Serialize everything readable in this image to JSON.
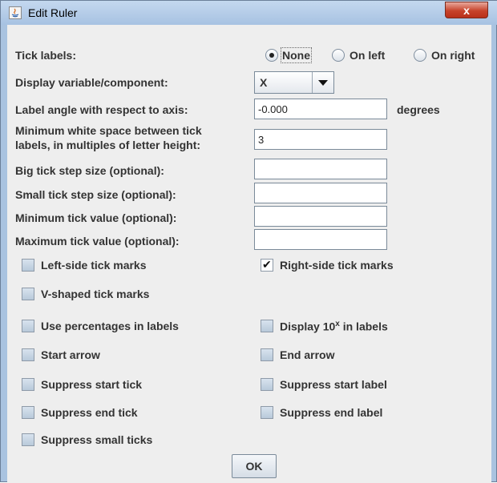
{
  "window": {
    "title": "Edit Ruler",
    "close_symbol": "x"
  },
  "tick_labels": {
    "label": "Tick labels:",
    "options": [
      "None",
      "On left",
      "On right"
    ],
    "selected": "None"
  },
  "display_variable": {
    "label": "Display variable/component:",
    "value": "X"
  },
  "label_angle": {
    "label": "Label angle with respect to axis:",
    "value": "-0.000",
    "unit": "degrees"
  },
  "min_white_space": {
    "label_line1": "Minimum white space between tick",
    "label_line2": "labels, in multiples of letter height:",
    "value": "3"
  },
  "big_tick_step": {
    "label": "Big tick step size (optional):",
    "value": ""
  },
  "small_tick_step": {
    "label": "Small tick step size (optional):",
    "value": ""
  },
  "min_tick_value": {
    "label": "Minimum tick value (optional):",
    "value": ""
  },
  "max_tick_value": {
    "label": "Maximum tick value (optional):",
    "value": ""
  },
  "checkboxes": {
    "left_side_ticks": {
      "label": "Left-side tick marks",
      "checked": false
    },
    "right_side_ticks": {
      "label": "Right-side tick marks",
      "checked": true
    },
    "v_shaped_ticks": {
      "label": "V-shaped tick marks",
      "checked": false
    },
    "use_percentages": {
      "label": "Use percentages in labels",
      "checked": false
    },
    "display_10x": {
      "label_prefix": "Display 10",
      "label_sup": "x",
      "label_suffix": " in labels",
      "checked": false
    },
    "start_arrow": {
      "label": "Start arrow",
      "checked": false
    },
    "end_arrow": {
      "label": "End arrow",
      "checked": false
    },
    "suppress_start_tick": {
      "label": "Suppress start tick",
      "checked": false
    },
    "suppress_start_label": {
      "label": "Suppress start label",
      "checked": false
    },
    "suppress_end_tick": {
      "label": "Suppress end tick",
      "checked": false
    },
    "suppress_end_label": {
      "label": "Suppress end label",
      "checked": false
    },
    "suppress_small_ticks": {
      "label": "Suppress small ticks",
      "checked": false
    }
  },
  "check_mark": "✔",
  "ok_button": {
    "label": "OK"
  }
}
